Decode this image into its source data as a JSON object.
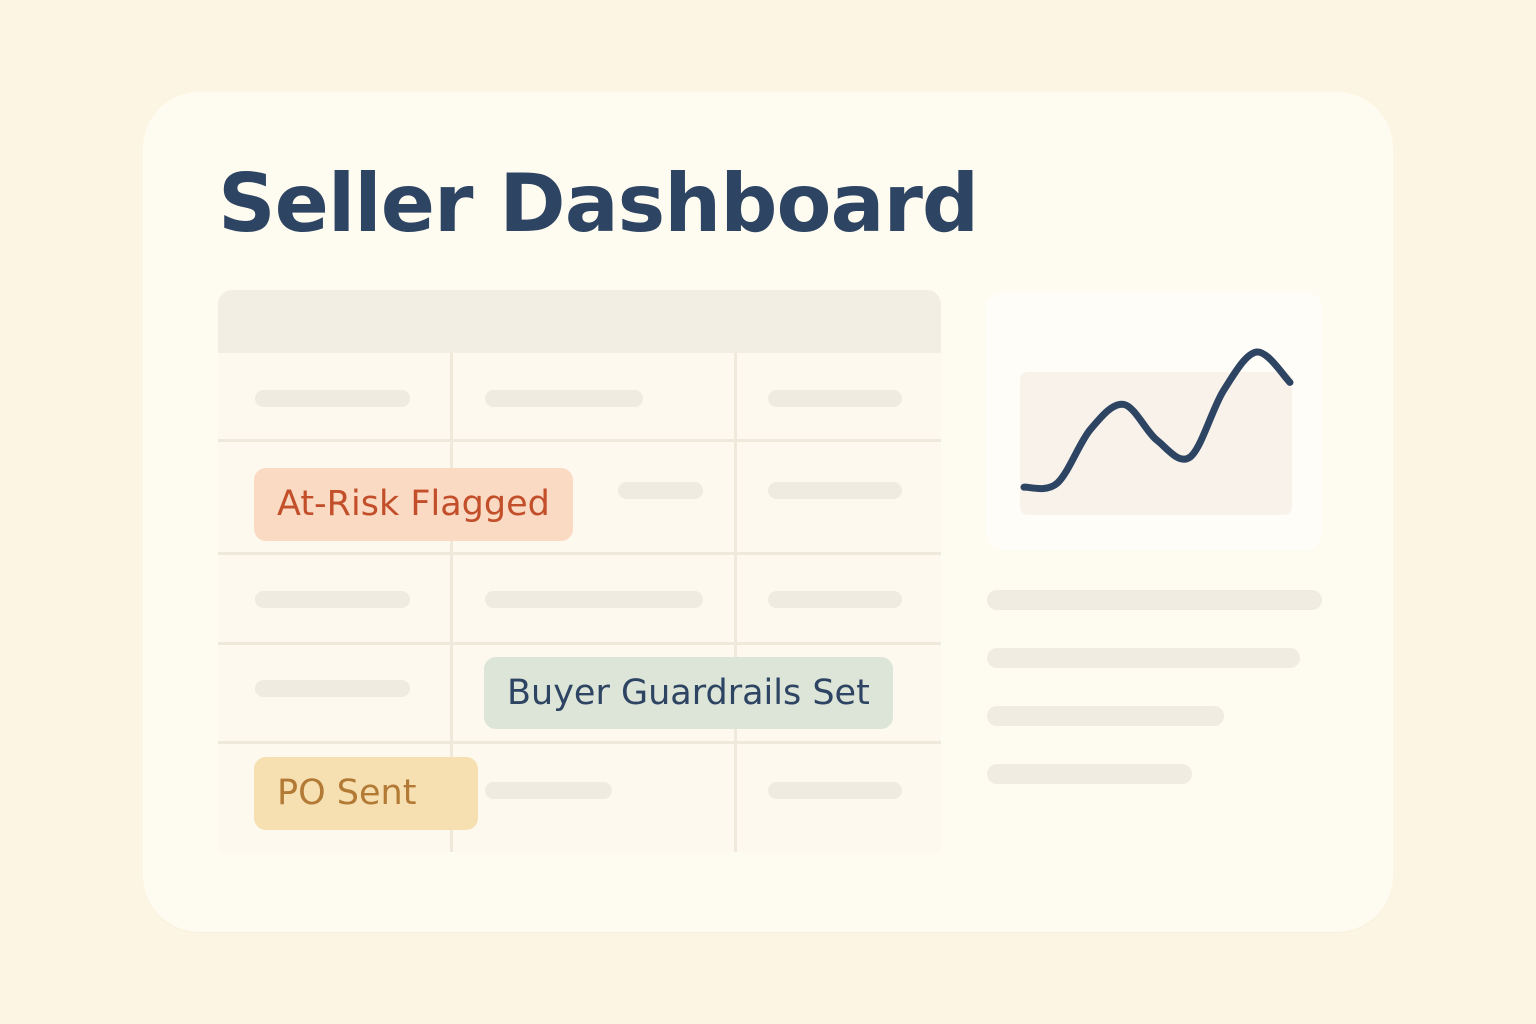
{
  "dashboard": {
    "title": "Seller Dashboard"
  },
  "table": {
    "tags": [
      {
        "label": "At-Risk Flagged",
        "color": "#c24f2a",
        "background": "#fbdac4"
      },
      {
        "label": "Buyer Guardrails Set",
        "color": "#2e4463",
        "background": "#dde5d8"
      },
      {
        "label": "PO Sent",
        "color": "#b27a34",
        "background": "#f6dfb0"
      }
    ]
  },
  "chart_data": {
    "type": "line",
    "title": "",
    "xlabel": "",
    "ylabel": "",
    "x": [
      0,
      1,
      2,
      3,
      4,
      5,
      6,
      7,
      8
    ],
    "series": [
      {
        "values": [
          0.1,
          0.25,
          2.2,
          3.1,
          1.8,
          1.2,
          3.6,
          5.0,
          3.9
        ]
      }
    ],
    "grid": false,
    "legend": "none",
    "line_color": "#2e4463"
  },
  "colors": {
    "page_background": "#fdf5e3",
    "card_background": "#fefbf0",
    "title": "#2e4463"
  }
}
